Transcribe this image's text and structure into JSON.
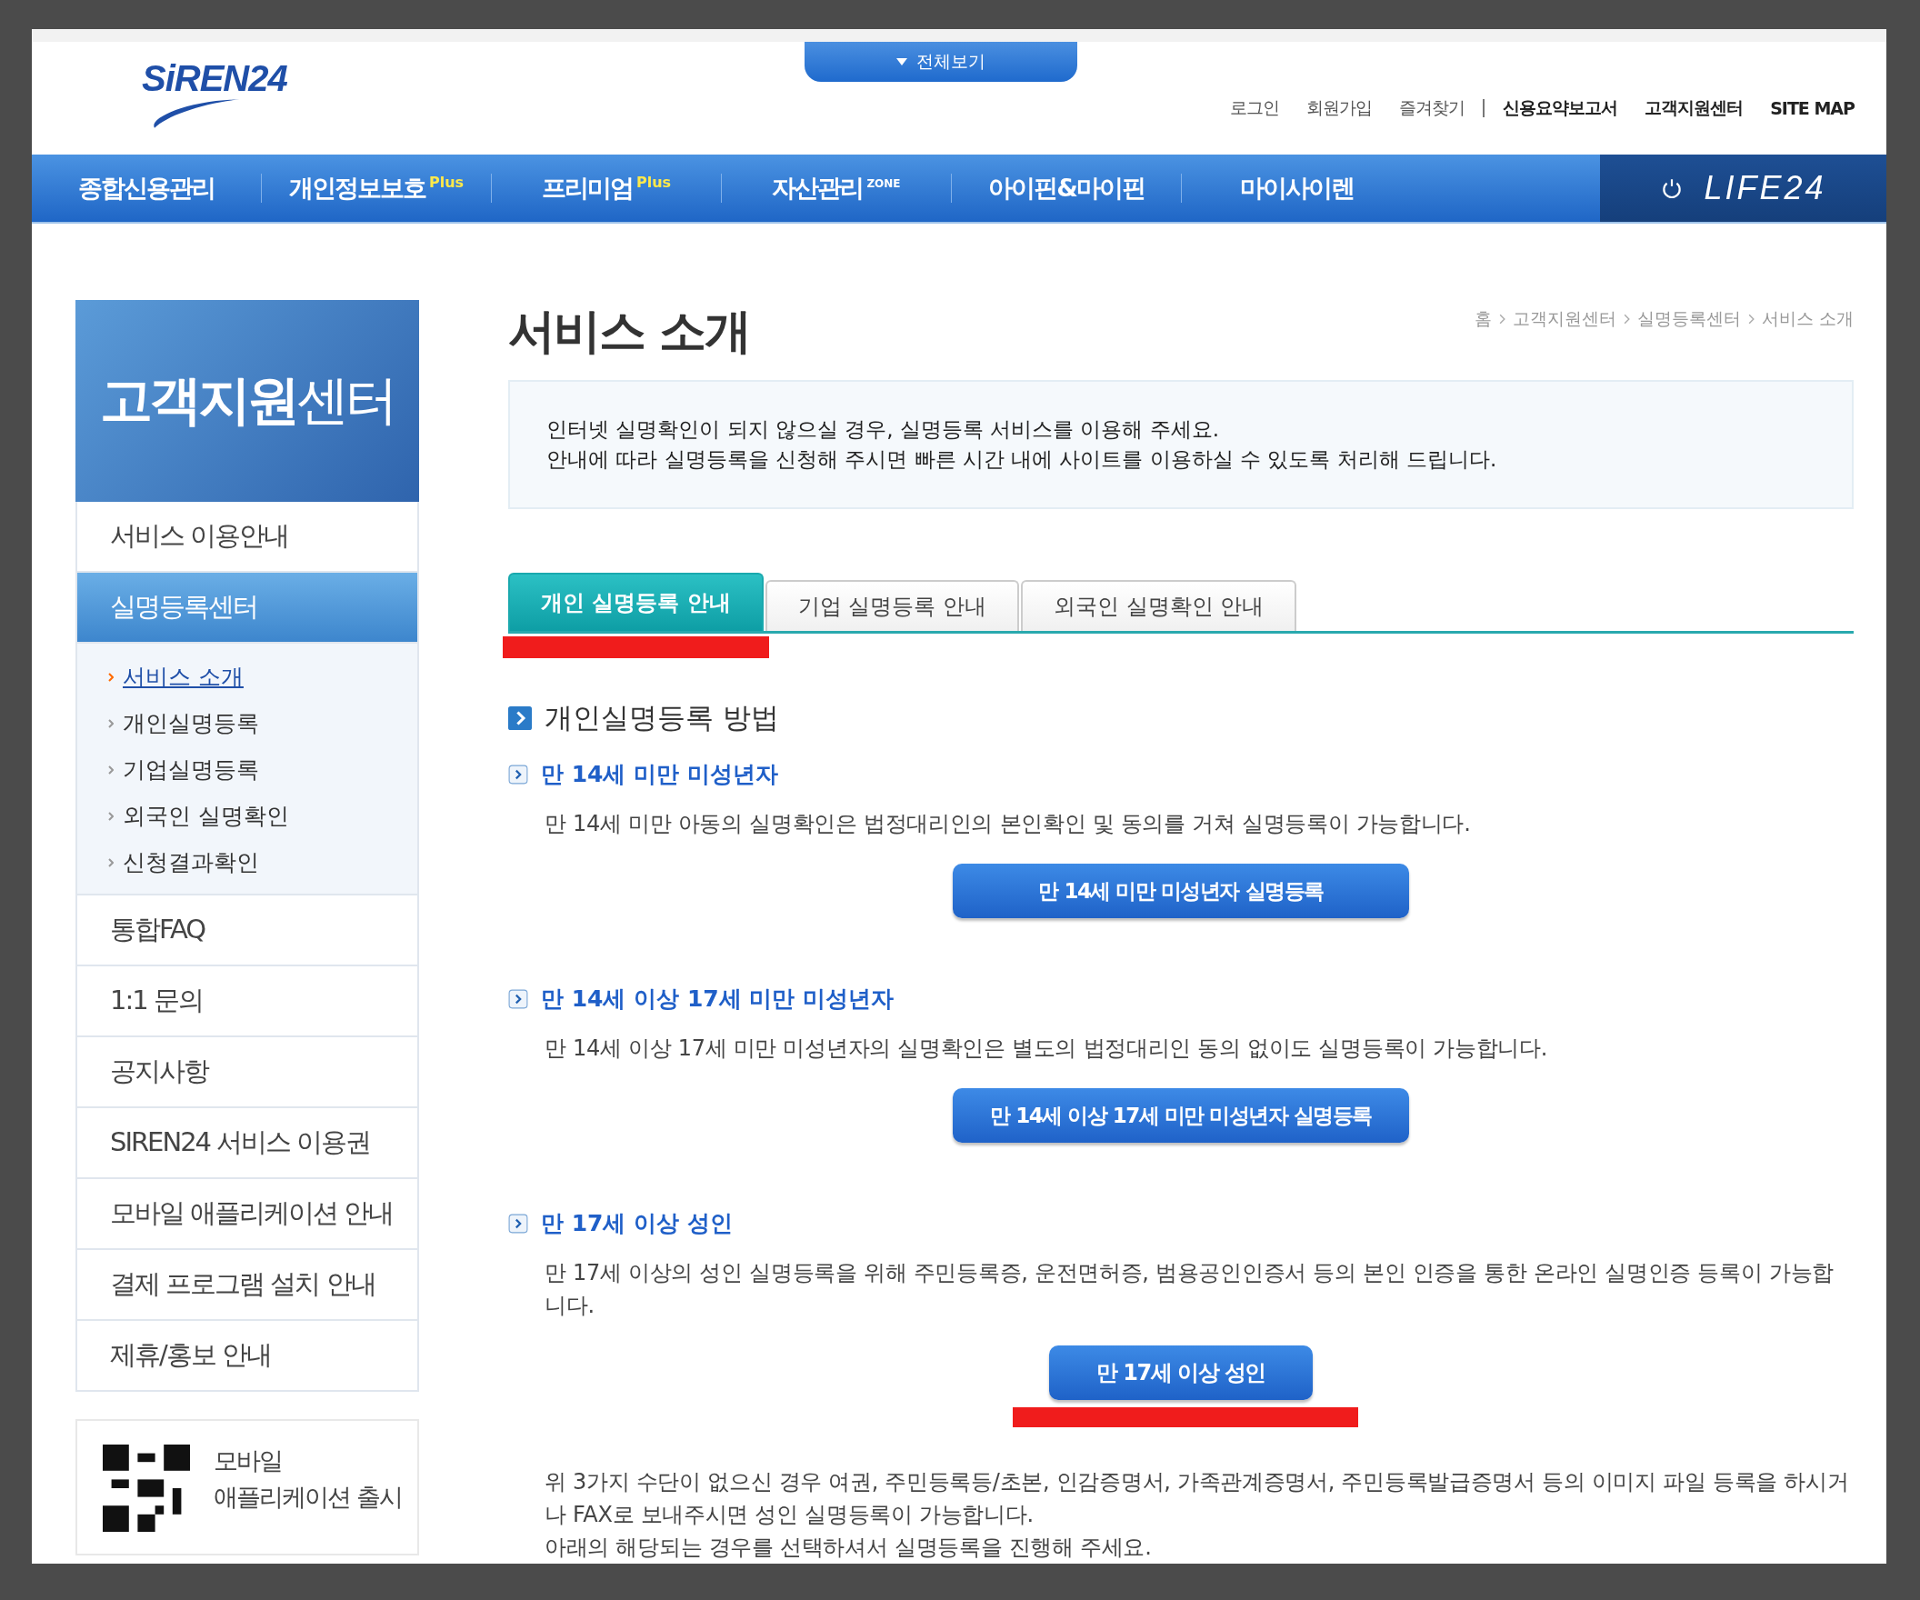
{
  "header": {
    "logo": "SiREN24",
    "menu_toggle": "전체보기",
    "top_links": [
      {
        "label": "로그인",
        "bold": false
      },
      {
        "label": "회원가입",
        "bold": false
      },
      {
        "label": "즐겨찾기",
        "bold": false
      },
      {
        "label": "신용요약보고서",
        "bold": true
      },
      {
        "label": "고객지원센터",
        "bold": true
      },
      {
        "label": "SITE MAP",
        "bold": true
      }
    ]
  },
  "nav": {
    "items": [
      {
        "label": "종합신용관리"
      },
      {
        "label": "개인정보보호",
        "badge": "Plus"
      },
      {
        "label": "프리미엄",
        "badge": "Plus"
      },
      {
        "label": "자산관리",
        "badge": "ZONE"
      },
      {
        "label": "아이핀&마이핀"
      },
      {
        "label": "마이사이렌"
      }
    ],
    "life": "LIFE24"
  },
  "sidebar": {
    "title": "**고객지원**센터",
    "items": [
      {
        "label": "서비스 이용안내",
        "selected": false
      },
      {
        "label": "실명등록센터",
        "selected": true,
        "children": [
          {
            "label": "서비스 소개",
            "selected": true
          },
          {
            "label": "개인실명등록",
            "selected": false
          },
          {
            "label": "기업실명등록",
            "selected": false
          },
          {
            "label": "외국인 실명확인",
            "selected": false
          },
          {
            "label": "신청결과확인",
            "selected": false
          }
        ]
      },
      {
        "label": "통합FAQ",
        "selected": false
      },
      {
        "label": "1:1 문의",
        "selected": false
      },
      {
        "label": "공지사항",
        "selected": false
      },
      {
        "label": "SIREN24 서비스 이용권",
        "selected": false
      },
      {
        "label": "모바일 애플리케이션 안내",
        "selected": false
      },
      {
        "label": "결제 프로그램 설치 안내",
        "selected": false
      },
      {
        "label": "제휴/홍보 안내",
        "selected": false
      }
    ],
    "promo": {
      "title": "모바일",
      "subtitle": "애플리케이션 출시"
    }
  },
  "main": {
    "title": "서비스 소개",
    "breadcrumb": [
      "홈",
      "고객지원센터",
      "실명등록센터",
      "서비스 소개"
    ],
    "intro": [
      "인터넷 실명확인이 되지 않으실 경우, 실명등록 서비스를 이용해 주세요.",
      "안내에 따라 실명등록을 신청해 주시면 빠른 시간 내에 사이트를 이용하실 수 있도록 처리해 드립니다."
    ],
    "tabs": [
      {
        "label": "개인 실명등록 안내",
        "selected": true
      },
      {
        "label": "기업 실명등록 안내",
        "selected": false
      },
      {
        "label": "외국인 실명확인 안내",
        "selected": false
      }
    ],
    "section_title": "개인실명등록 방법",
    "subsections": [
      {
        "heading": "만 14세 미만 미성년자",
        "text": "만 14세 미만 아동의 실명확인은 법정대리인의 본인확인 및 동의를 거쳐 실명등록이 가능합니다.",
        "button": "만 14세 미만 미성년자 실명등록"
      },
      {
        "heading": "만 14세 이상 17세 미만 미성년자",
        "text": "만 14세 이상 17세 미만 미성년자의 실명확인은 별도의 법정대리인 동의 없이도 실명등록이 가능합니다.",
        "button": "만 14세 이상 17세 미만 미성년자 실명등록"
      },
      {
        "heading": "만 17세 이상 성인",
        "text": "만 17세 이상의 성인 실명등록을 위해 주민등록증, 운전면허증, 범용공인인증서 등의 본인 인증을 통한 온라인 실명인증 등록이 가능합니다.",
        "button": "만 17세 이상 성인",
        "marked": true
      }
    ],
    "notes": [
      "위 3가지 수단이 없으신 경우 여권, 주민등록등/초본, 인감증명서, 가족관계증명서, 주민등록발급증명서 등의 이미지 파일 등록을 하시거나 FAX로 보내주시면 성인 실명등록이 가능합니다.",
      "아래의 해당되는 경우를 선택하셔서 실명등록을 진행해 주세요."
    ]
  }
}
